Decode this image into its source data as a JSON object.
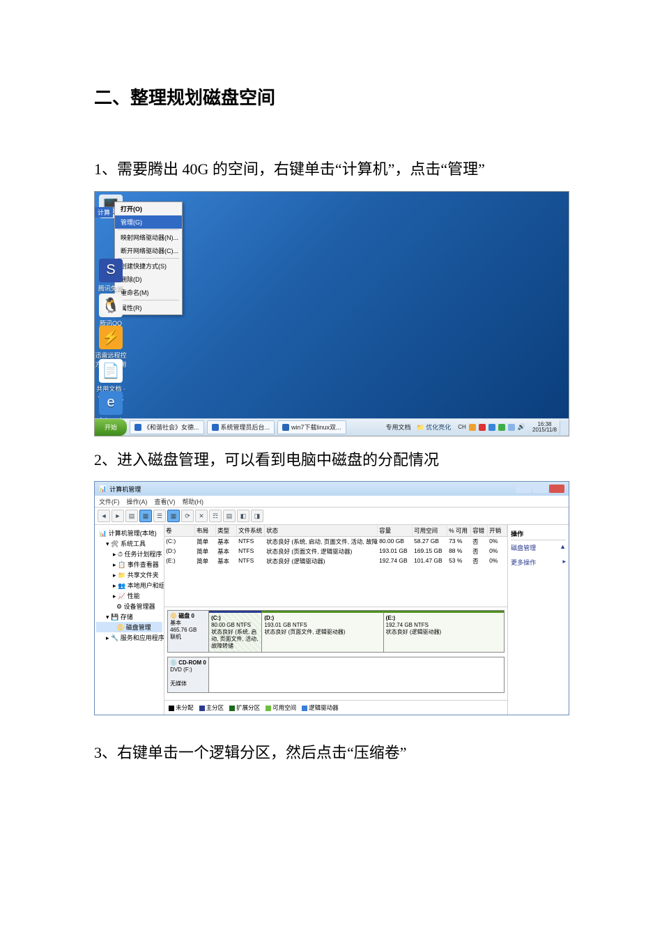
{
  "doc": {
    "heading": "二、整理规划磁盘空间",
    "p1": "1、需要腾出 40G 的空间，右键单击“计算机”，点击“管理”",
    "p2": "2、进入磁盘管理，可以看到电脑中磁盘的分配情况",
    "p3": "3、右键单击一个逻辑分区，然后点击“压缩卷”"
  },
  "ctx": {
    "computer_label": "计算",
    "items": {
      "open": "打开(O)",
      "manage": "管理(G)",
      "map": "映射网络驱动器(N)...",
      "disconnect": "断开网络驱动器(C)...",
      "shortcut": "创建快捷方式(S)",
      "delete": "删除(D)",
      "rename": "重命名(M)",
      "properties": "属性(R)"
    }
  },
  "desk": {
    "s": {
      "label": "腾讯免费\n邮"
    },
    "qq": {
      "label": "腾讯QQ"
    },
    "dl": {
      "label": "迅雷远程控\n方便您使用"
    },
    "docs": {
      "label": "共用文档 · 快捷方式"
    },
    "ie": {
      "label": "Internet\nExplo..."
    }
  },
  "taskbar": {
    "start": "开始",
    "btn1": "《和谐社会》女德...",
    "btn2": "系统管理员后台...",
    "btn3": "win7下载linux双...",
    "docs": "专用文档",
    "opt": "优化亮化",
    "ime": "CH",
    "time": "16:38",
    "date": "2015/11/8"
  },
  "mgmt": {
    "title": "计算机管理",
    "menu": {
      "file": "文件(F)",
      "action": "操作(A)",
      "view": "查看(V)",
      "help": "帮助(H)"
    },
    "tree": {
      "root": "计算机管理(本地)",
      "sys": "系统工具",
      "sched": "任务计划程序",
      "evt": "事件查看器",
      "share": "共享文件夹",
      "users": "本地用户和组",
      "perf": "性能",
      "dev": "设备管理器",
      "storage": "存储",
      "disk": "磁盘管理",
      "svc": "服务和应用程序"
    },
    "cols": {
      "vol": "卷",
      "layout": "布局",
      "type": "类型",
      "fs": "文件系统",
      "status": "状态",
      "cap": "容量",
      "free": "可用空间",
      "pct": "% 可用",
      "fault": "容错",
      "oh": "开销"
    },
    "rows": [
      {
        "vol": "(C:)",
        "layout": "简单",
        "type": "基本",
        "fs": "NTFS",
        "status": "状态良好 (系统, 启动, 页面文件, 活动, 故障转储, 主分区)",
        "cap": "80.00 GB",
        "free": "58.27 GB",
        "pct": "73 %",
        "fault": "否",
        "oh": "0%"
      },
      {
        "vol": "(D:)",
        "layout": "简单",
        "type": "基本",
        "fs": "NTFS",
        "status": "状态良好 (页面文件, 逻辑驱动器)",
        "cap": "193.01 GB",
        "free": "169.15 GB",
        "pct": "88 %",
        "fault": "否",
        "oh": "0%"
      },
      {
        "vol": "(E:)",
        "layout": "简单",
        "type": "基本",
        "fs": "NTFS",
        "status": "状态良好 (逻辑驱动器)",
        "cap": "192.74 GB",
        "free": "101.47 GB",
        "pct": "53 %",
        "fault": "否",
        "oh": "0%"
      }
    ],
    "disk0": {
      "label": "磁盘 0",
      "kind": "基本",
      "size": "465.76 GB",
      "state": "联机",
      "c": {
        "h": "(C:)",
        "l1": "80.00 GB NTFS",
        "l2": "状态良好 (系统, 启动, 页面文件, 活动, 故障转储"
      },
      "d": {
        "h": "(D:)",
        "l1": "193.01 GB NTFS",
        "l2": "状态良好 (页面文件, 逻辑驱动器)"
      },
      "e": {
        "h": "(E:)",
        "l1": "192.74 GB NTFS",
        "l2": "状态良好 (逻辑驱动器)"
      }
    },
    "cd": {
      "label": "CD-ROM 0",
      "sub": "DVD (F:)",
      "state": "无媒体"
    },
    "legend": {
      "a": "未分配",
      "b": "主分区",
      "c": "扩展分区",
      "d": "可用空间",
      "e": "逻辑驱动器"
    },
    "actions": {
      "hdr": "操作",
      "dm": "磁盘管理",
      "more": "更多操作"
    }
  }
}
